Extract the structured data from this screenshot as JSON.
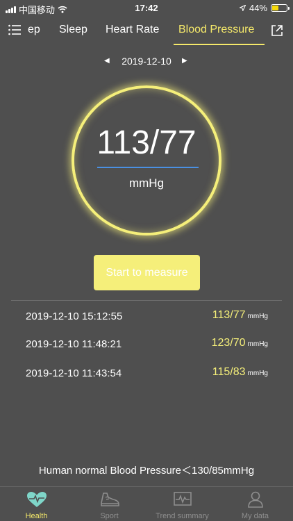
{
  "status_bar": {
    "carrier": "中国移动",
    "time": "17:42",
    "battery": "44%",
    "battery_level": 0.44
  },
  "tabs": [
    {
      "label": "ep"
    },
    {
      "label": "Sleep"
    },
    {
      "label": "Heart Rate"
    },
    {
      "label": "Blood Pressure"
    }
  ],
  "active_tab": "Blood Pressure",
  "date": "2019-12-10",
  "gauge": {
    "value": "113/77",
    "unit": "mmHg"
  },
  "measure_button": "Start to measure",
  "records": [
    {
      "time": "2019-12-10 15:12:55",
      "value": "113/77",
      "unit": "mmHg"
    },
    {
      "time": "2019-12-10 11:48:21",
      "value": "123/70",
      "unit": "mmHg"
    },
    {
      "time": "2019-12-10 11:43:54",
      "value": "115/83",
      "unit": "mmHg"
    }
  ],
  "normal_info": "Human normal Blood Pressure＜130/85mmHg",
  "bottom_nav": [
    {
      "label": "Health",
      "icon": "heart-icon"
    },
    {
      "label": "Sport",
      "icon": "shoe-icon"
    },
    {
      "label": "Trend summary",
      "icon": "trend-icon"
    },
    {
      "label": "My data",
      "icon": "person-icon"
    }
  ],
  "colors": {
    "background": "#4f4f4f",
    "accent": "#f5ef7a",
    "gauge_line": "#4a90e2",
    "inactive_nav": "#8e8e8e"
  }
}
